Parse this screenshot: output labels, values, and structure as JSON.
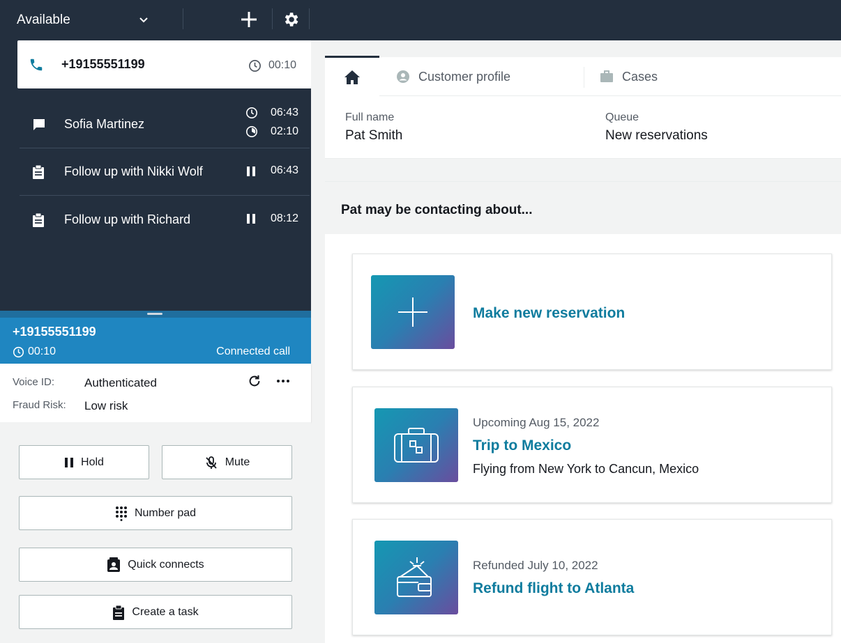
{
  "topbar": {
    "status": "Available",
    "icons": [
      "chevron-down-icon",
      "plus-icon",
      "gear-icon"
    ]
  },
  "contacts": {
    "active": {
      "number": "+19155551199",
      "time": "00:10"
    },
    "items": [
      {
        "label": "Sofia Martinez",
        "time1": "06:43",
        "time2": "02:10",
        "icon": "chat-icon"
      },
      {
        "label": "Follow up with Nikki Wolf",
        "time": "06:43",
        "icon": "task-icon"
      },
      {
        "label": "Follow up with Richard",
        "time": "08:12",
        "icon": "task-icon"
      }
    ]
  },
  "call": {
    "number": "+19155551199",
    "time": "00:10",
    "status": "Connected call",
    "voice_id_label": "Voice ID:",
    "voice_id_value": "Authenticated",
    "fraud_label": "Fraud Risk:",
    "fraud_value": "Low risk"
  },
  "actions": {
    "hold": "Hold",
    "mute": "Mute",
    "number_pad": "Number pad",
    "quick_connects": "Quick connects",
    "create_task": "Create a task"
  },
  "tabs": {
    "customer_profile": "Customer profile",
    "cases": "Cases"
  },
  "profile": {
    "full_name_label": "Full name",
    "full_name_value": "Pat Smith",
    "queue_label": "Queue",
    "queue_value": "New reservations"
  },
  "suggestions": {
    "heading": "Pat may be contacting about...",
    "items": [
      {
        "title": "Make new reservation"
      },
      {
        "meta": "Upcoming Aug 15, 2022",
        "title": "Trip to Mexico",
        "desc": "Flying from New York to Cancun, Mexico"
      },
      {
        "meta": "Refunded July 10, 2022",
        "title": "Refund flight to Atlanta"
      }
    ]
  },
  "colors": {
    "topbar": "#232f3e",
    "call_header": "#1f86c1",
    "link": "#0f7c9e"
  }
}
